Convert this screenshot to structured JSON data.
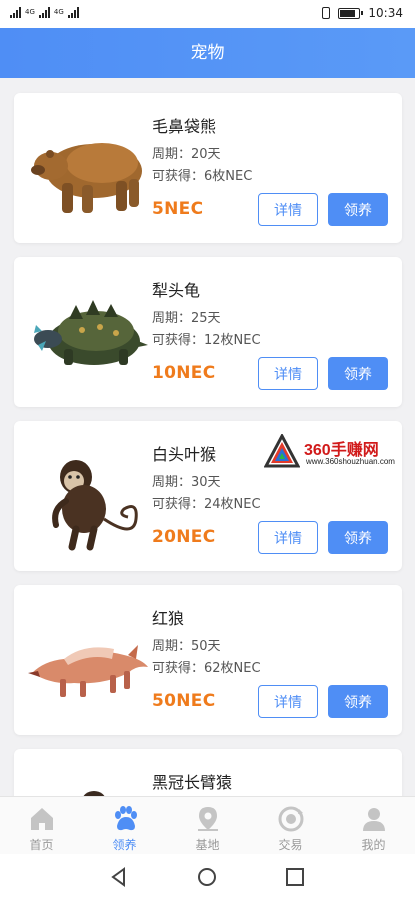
{
  "status_bar": {
    "net_left": "4G",
    "net_right": "4G",
    "time": "10:34",
    "battery_level": 0.85
  },
  "header": {
    "title": "宠物"
  },
  "pets": [
    {
      "name": "毛鼻袋熊",
      "period": "周期：20天",
      "reward": "可获得：6枚NEC",
      "price": "5NEC",
      "detail_label": "详情",
      "adopt_label": "领养",
      "image": "bear"
    },
    {
      "name": "犁头龟",
      "period": "周期：25天",
      "reward": "可获得：12枚NEC",
      "price": "10NEC",
      "detail_label": "详情",
      "adopt_label": "领养",
      "image": "turtle"
    },
    {
      "name": "白头叶猴",
      "period": "周期：30天",
      "reward": "可获得：24枚NEC",
      "price": "20NEC",
      "detail_label": "详情",
      "adopt_label": "领养",
      "image": "monkey"
    },
    {
      "name": "红狼",
      "period": "周期：50天",
      "reward": "可获得：62枚NEC",
      "price": "50NEC",
      "detail_label": "详情",
      "adopt_label": "领养",
      "image": "wolf"
    },
    {
      "name": "黑冠长臂猿",
      "period": "",
      "reward": "",
      "price": "",
      "detail_label": "",
      "adopt_label": "",
      "image": "gibbon"
    }
  ],
  "watermark": {
    "brand": "360手赚网",
    "url": "www.360shouzhuan.com"
  },
  "tabbar": {
    "active": "领养",
    "items": [
      {
        "label": "首页",
        "icon": "home-icon"
      },
      {
        "label": "领养",
        "icon": "paw-icon"
      },
      {
        "label": "基地",
        "icon": "location-pin-icon"
      },
      {
        "label": "交易",
        "icon": "exchange-icon"
      },
      {
        "label": "我的",
        "icon": "user-icon"
      }
    ]
  },
  "colors": {
    "header": "#4f8ef5",
    "accent": "#4f8ef5",
    "price": "#ef7b1c",
    "background": "#f1f1f3"
  }
}
